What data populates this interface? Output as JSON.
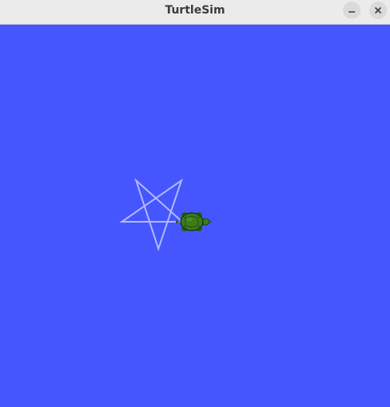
{
  "window": {
    "title": "TurtleSim",
    "controls": {
      "minimize_icon": "minimize-icon",
      "close_icon": "close-icon"
    }
  },
  "canvas": {
    "background_color": "#4556ff",
    "pen_color": "#b3b8ff",
    "drawing": "pentagram-star",
    "turtle_icon": "turtle-icon",
    "turtle_color": "#3a7d1c"
  }
}
